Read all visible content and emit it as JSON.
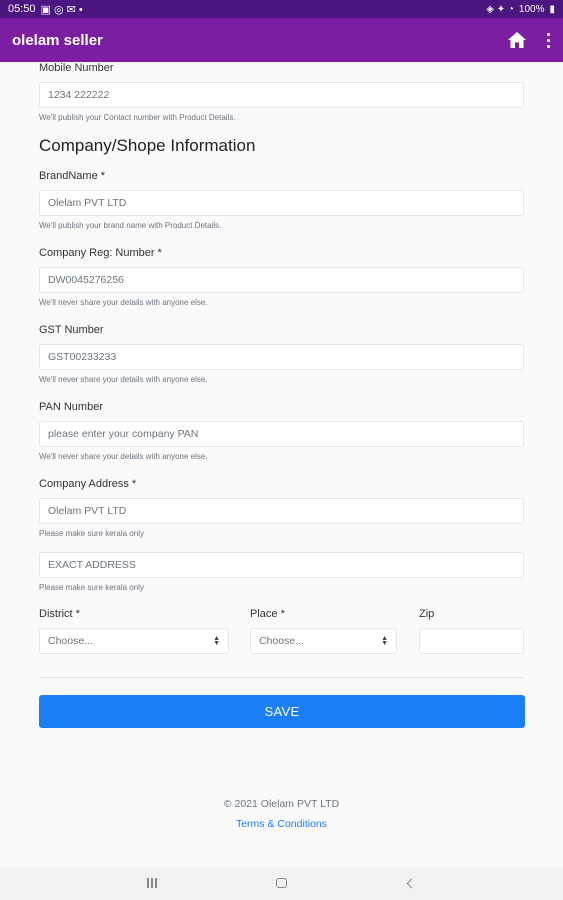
{
  "status_bar": {
    "time": "05:50",
    "battery": "100%"
  },
  "app_bar": {
    "title": "olelam seller"
  },
  "form": {
    "mobile": {
      "label": "Mobile Number",
      "value": "1234 222222",
      "hint": "We'll publish your Contact number with Product Details."
    },
    "section_title": "Company/Shope Information",
    "brand": {
      "label": "BrandName *",
      "value": "Olelam PVT LTD",
      "hint": "We'll publish your brand name with Product Details."
    },
    "reg": {
      "label": "Company Reg: Number *",
      "value": "DW0045276256",
      "hint": "We'll never share your details with anyone else."
    },
    "gst": {
      "label": "GST Number",
      "value": "GST00233233",
      "hint": "We'll never share your details with anyone else."
    },
    "pan": {
      "label": "PAN Number",
      "placeholder": "please enter your company PAN",
      "hint": "We'll never share your details with anyone else."
    },
    "address": {
      "label": "Company Address *",
      "value": "Olelam PVT LTD",
      "hint": "Please make sure kerala only"
    },
    "exact_address": {
      "placeholder": "EXACT ADDRESS",
      "hint": "Please make sure kerala only"
    },
    "district": {
      "label": "District *",
      "selected": "Choose..."
    },
    "place": {
      "label": "Place *",
      "selected": "Choose..."
    },
    "zip": {
      "label": "Zip",
      "value": ""
    },
    "save_label": "SAVE"
  },
  "footer": {
    "copyright": "© 2021 Olelam PVT LTD",
    "terms": "Terms & Conditions"
  },
  "colors": {
    "status_bar": "#4b1680",
    "app_bar": "#7b1fa2",
    "primary_button": "#1a7ef5"
  },
  "icons": [
    "home-icon",
    "more-vert-icon",
    "recents-icon",
    "home-nav-icon",
    "back-icon"
  ]
}
